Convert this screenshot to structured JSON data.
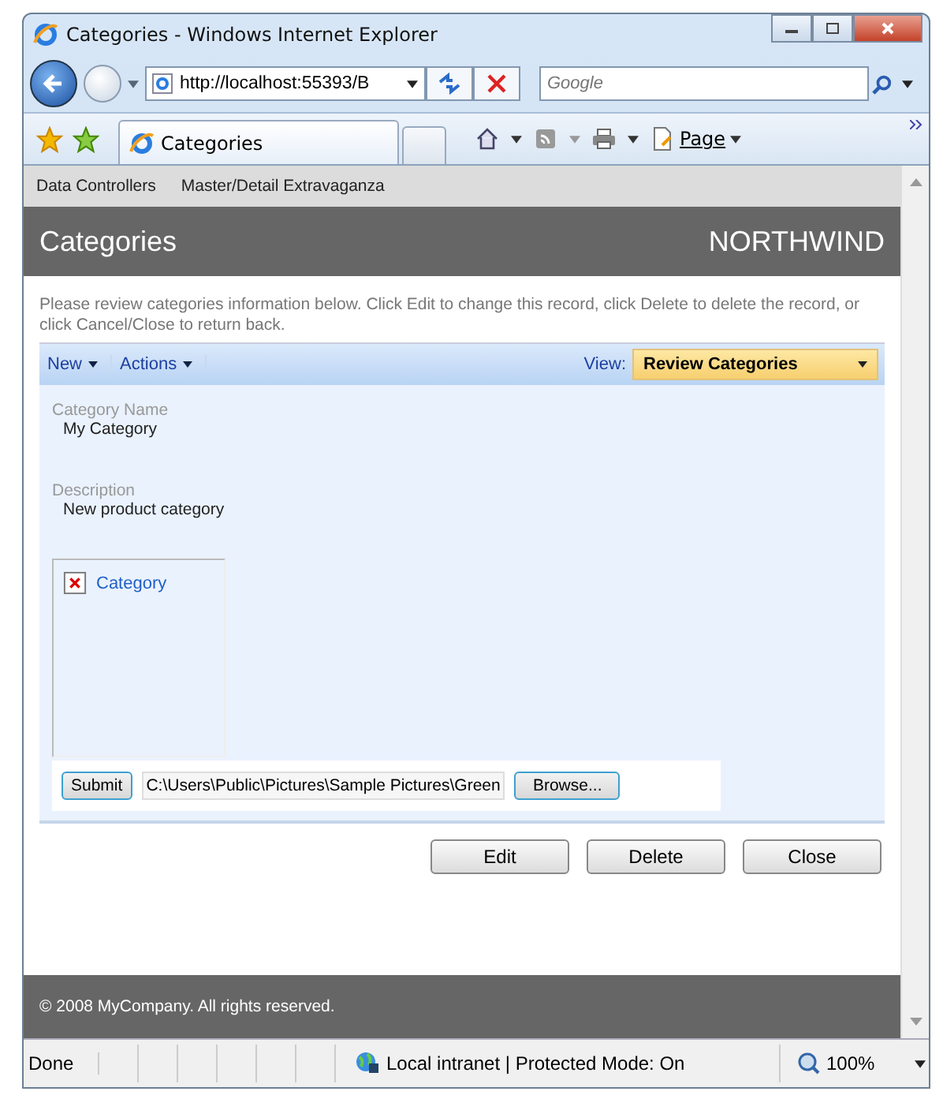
{
  "window": {
    "title": "Categories - Windows Internet Explorer"
  },
  "address_bar": {
    "value": "http://localhost:55393/B"
  },
  "search": {
    "placeholder": "Google"
  },
  "tabs": [
    {
      "label": "Categories",
      "selected": true
    }
  ],
  "command_bar": {
    "page_menu": "Page"
  },
  "page": {
    "breadcrumbs": [
      "Data Controllers",
      "Master/Detail Extravaganza"
    ],
    "title": "Categories",
    "brand": "NORTHWIND",
    "instructions": "Please review categories information below. Click Edit to change this record, click Delete to delete the record, or click Cancel/Close to return back.",
    "toolbar": {
      "menus": [
        "New",
        "Actions"
      ],
      "view_label": "View:",
      "view_value": "Review Categories"
    },
    "fields": [
      {
        "label": "Category Name",
        "value": "My Category"
      },
      {
        "label": "Description",
        "value": "New product category"
      }
    ],
    "image": {
      "alt": "Category"
    },
    "upload": {
      "submit": "Submit",
      "file_path": "C:\\Users\\Public\\Pictures\\Sample Pictures\\Green",
      "browse": "Browse..."
    },
    "actions": [
      "Edit",
      "Delete",
      "Close"
    ],
    "footer": "© 2008 MyCompany. All rights reserved."
  },
  "status_bar": {
    "status": "Done",
    "zone": "Local intranet | Protected Mode: On",
    "zoom": "100%"
  }
}
